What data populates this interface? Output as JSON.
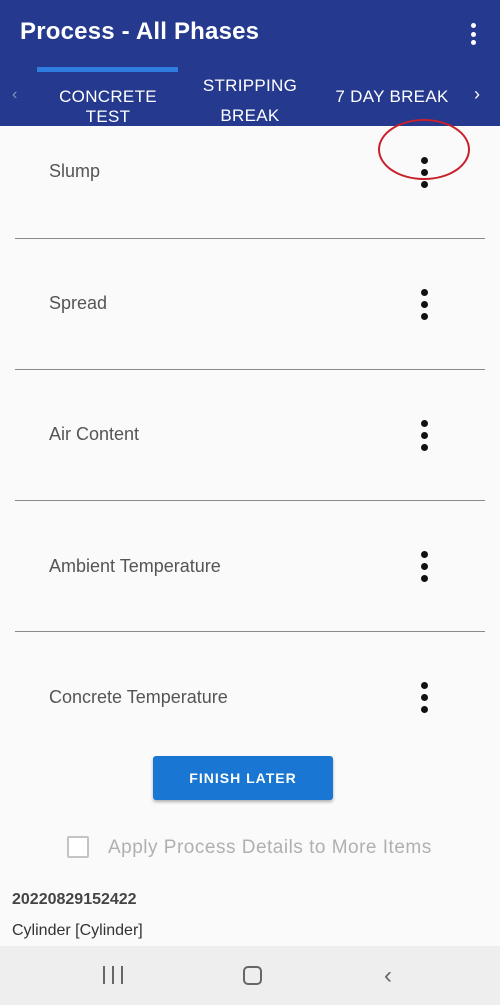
{
  "app_bar": {
    "title": "Process - All Phases",
    "overflow_icon": "more-vert-icon"
  },
  "tabs": {
    "left_arrow": "‹",
    "right_arrow": "›",
    "items": [
      {
        "label": "CONCRETE TEST",
        "selected": true
      },
      {
        "label_line1": "STRIPPING",
        "label_line2": "BREAK",
        "selected": false
      },
      {
        "label": "7 DAY BREAK",
        "selected": false
      }
    ]
  },
  "tests": [
    {
      "label": "Slump",
      "highlighted": true
    },
    {
      "label": "Spread"
    },
    {
      "label": "Air Content"
    },
    {
      "label": "Ambient Temperature"
    },
    {
      "label": "Concrete Temperature"
    }
  ],
  "actions": {
    "finish_later_label": "FINISH LATER",
    "apply_details_label": "Apply Process Details to More Items",
    "apply_details_checked": false
  },
  "item": {
    "id": "20220829152422",
    "type": "Cylinder [Cylinder]"
  },
  "colors": {
    "app_bar": "#253a8f",
    "tab_indicator": "#2f7de1",
    "primary_button": "#1976d2",
    "highlight_ring": "#c8212b"
  }
}
